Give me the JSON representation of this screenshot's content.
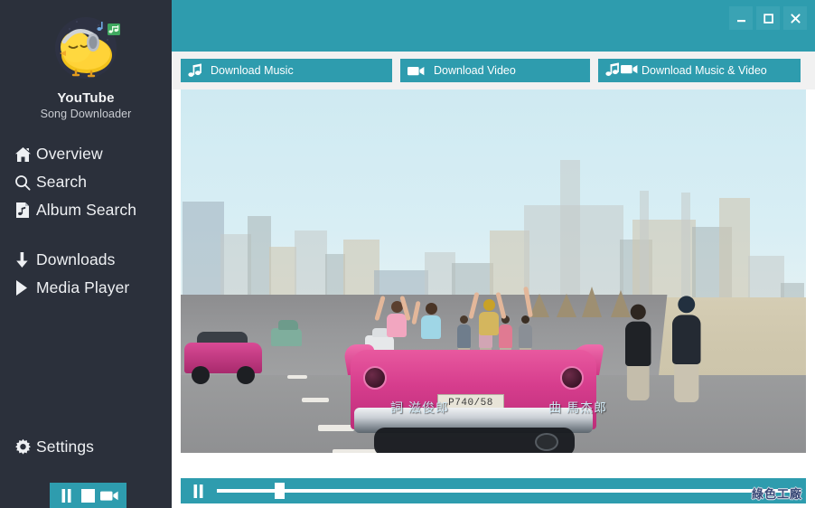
{
  "app": {
    "brand_title": "YouTube",
    "brand_subtitle": "Song Downloader",
    "logo_icon": "chick-headphones-logo"
  },
  "sidebar": {
    "groups": [
      {
        "items": [
          {
            "label": "Overview",
            "icon": "home-icon"
          },
          {
            "label": "Search",
            "icon": "search-icon"
          },
          {
            "label": "Album Search",
            "icon": "album-music-icon"
          }
        ]
      },
      {
        "items": [
          {
            "label": "Downloads",
            "icon": "download-arrow-icon"
          },
          {
            "label": "Media Player",
            "icon": "play-triangle-icon"
          }
        ]
      }
    ],
    "settings": {
      "label": "Settings",
      "icon": "gear-icon"
    },
    "mini_controls": [
      {
        "name": "pause-button",
        "icon": "pause-icon"
      },
      {
        "name": "stop-button",
        "icon": "stop-square-icon"
      },
      {
        "name": "video-button",
        "icon": "video-camera-icon"
      }
    ]
  },
  "titlebar": {
    "minimize_label": "–",
    "maximize_label": "☐",
    "close_label": "✕",
    "minimize_icon": "minimize-icon",
    "maximize_icon": "maximize-icon",
    "close_icon": "close-icon"
  },
  "tabs": [
    {
      "label": "Download Music",
      "icons": [
        "music-note-icon"
      ]
    },
    {
      "label": "Download Video",
      "icons": [
        "video-camera-icon"
      ]
    },
    {
      "label": "Download Music & Video",
      "icons": [
        "music-note-icon",
        "video-camera-icon"
      ]
    }
  ],
  "video": {
    "license_plate": "P740/58",
    "subtitle_left": "詞 滋俊郎",
    "subtitle_right": "曲 馬杰郎"
  },
  "player": {
    "play_pause_icon": "pause-icon",
    "progress_percent": 10
  },
  "watermark": {
    "text": "綠色工廠"
  },
  "colors": {
    "sidebar_bg": "#2b303b",
    "accent_teal": "#2e9cae",
    "tabstrip_bg": "#f1f1f1",
    "text_light": "#eef0f3"
  }
}
